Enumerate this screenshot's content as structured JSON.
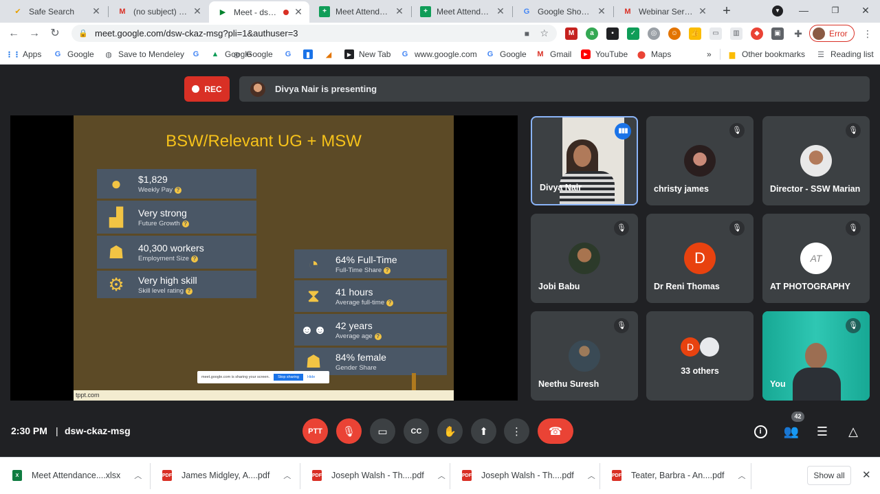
{
  "tabs": [
    {
      "label": "Safe Search",
      "icon": "checkmark-icon",
      "active": false
    },
    {
      "label": "(no subject) - cha",
      "icon": "gmail-icon",
      "active": false
    },
    {
      "label": "Meet - dsw-c",
      "icon": "meet-icon",
      "active": true
    },
    {
      "label": "Meet Attendance",
      "icon": "sheets-icon",
      "active": false
    },
    {
      "label": "Meet Attendance",
      "icon": "sheets-icon",
      "active": false
    },
    {
      "label": "Google Shopping",
      "icon": "google-icon",
      "active": false
    },
    {
      "label": "Webinar Series o",
      "icon": "gmail-icon",
      "active": false
    }
  ],
  "address_bar": {
    "url": "meet.google.com/dsw-ckaz-msg?pli=1&authuser=3"
  },
  "profile": {
    "status": "Error"
  },
  "bookmarks": [
    "Apps",
    "Google",
    "Save to Mendeley",
    "",
    "Google",
    "",
    "",
    "",
    "New Tab",
    "www.google.com",
    "Google",
    "Gmail",
    "YouTube",
    "Maps"
  ],
  "bookmarks_more": "»",
  "other_bookmarks": "Other bookmarks",
  "reading_list": "Reading list",
  "meet": {
    "rec_label": "REC",
    "presenting_text": "Divya Nair is presenting",
    "slide": {
      "title": "BSW/Relevant UG + MSW",
      "left_cards": [
        {
          "main": "$1,829",
          "sub": "Weekly Pay"
        },
        {
          "main": "Very strong",
          "sub": "Future Growth"
        },
        {
          "main": "40,300 workers",
          "sub": "Employment Size"
        },
        {
          "main": "Very high skill",
          "sub": "Skill level rating"
        }
      ],
      "right_cards": [
        {
          "main": "64% Full-Time",
          "sub": "Full-Time Share"
        },
        {
          "main": "41 hours",
          "sub": "Average full-time"
        },
        {
          "main": "42 years",
          "sub": "Average age"
        },
        {
          "main": "84% female",
          "sub": "Gender Share"
        }
      ],
      "footer": "tppt.com",
      "share_notice": "meet.google.com is sharing your screen.",
      "share_stop": "Stop sharing",
      "share_hide": "Hide"
    },
    "participants": [
      {
        "name": "Divya Nair"
      },
      {
        "name": "christy james"
      },
      {
        "name": "Director - SSW Marian"
      },
      {
        "name": "Jobi Babu"
      },
      {
        "name": "Dr Reni Thomas",
        "initial": "D"
      },
      {
        "name": "AT PHOTOGRAPHY"
      },
      {
        "name": "Neethu Suresh"
      },
      {
        "name": "33 others",
        "initial": "D"
      },
      {
        "name": "You"
      }
    ],
    "time": "2:30 PM",
    "separator": "|",
    "meeting_code": "dsw-ckaz-msg",
    "people_count": "42"
  },
  "downloads": [
    {
      "name": "Meet Attendance....xlsx",
      "type": "xlsx"
    },
    {
      "name": "James Midgley, A....pdf",
      "type": "pdf"
    },
    {
      "name": "Joseph Walsh - Th....pdf",
      "type": "pdf"
    },
    {
      "name": "Joseph Walsh - Th....pdf",
      "type": "pdf"
    },
    {
      "name": "Teater, Barbra - An....pdf",
      "type": "pdf"
    }
  ],
  "show_all": "Show all",
  "colors": {
    "rec": "#d93025",
    "accent": "#1a73e8",
    "slide_title": "#f6c21a",
    "end_call": "#ea4335"
  }
}
